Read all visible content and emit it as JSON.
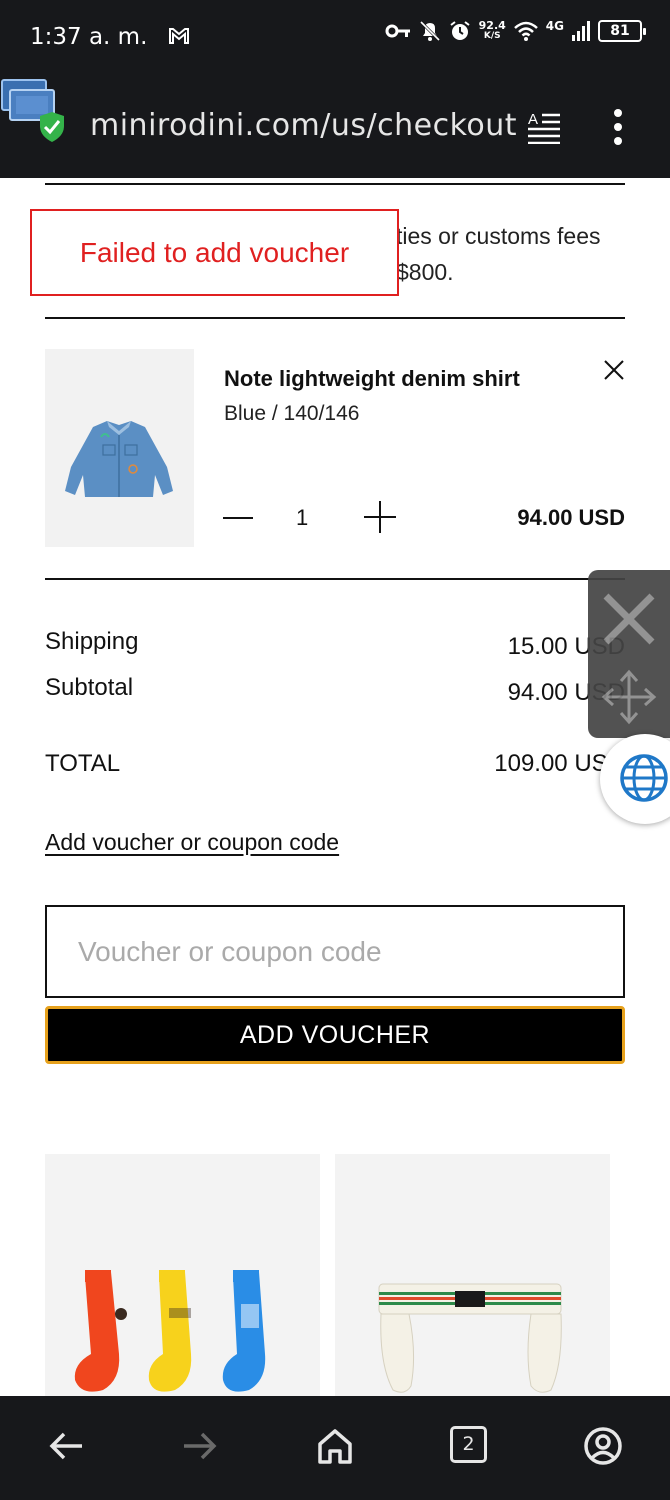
{
  "status_bar": {
    "time": "1:37 a. m.",
    "speed_value": "92.4",
    "speed_unit": "K/S",
    "network": "4G",
    "battery": "81"
  },
  "browser": {
    "url": "minirodini.com/us/checkout",
    "tab_count": "2"
  },
  "checkout": {
    "notice_line1": "ties or customs fees",
    "notice_line2": "$800.",
    "toast": "Failed to add voucher",
    "item": {
      "name": "Note lightweight denim shirt",
      "variant": "Blue / 140/146",
      "quantity": "1",
      "price": "94.00 USD"
    },
    "summary": {
      "shipping_label": "Shipping",
      "shipping_value": "15.00 USD",
      "subtotal_label": "Subtotal",
      "subtotal_value": "94.00 USD",
      "total_label": "TOTAL",
      "total_value": "109.00 USD"
    },
    "voucher": {
      "link": "Add voucher or coupon code",
      "placeholder": "Voucher or coupon code",
      "button": "ADD VOUCHER"
    }
  },
  "colors": {
    "error": "#e02020",
    "button_border": "#e6a11c",
    "system_bar": "#17181b"
  }
}
